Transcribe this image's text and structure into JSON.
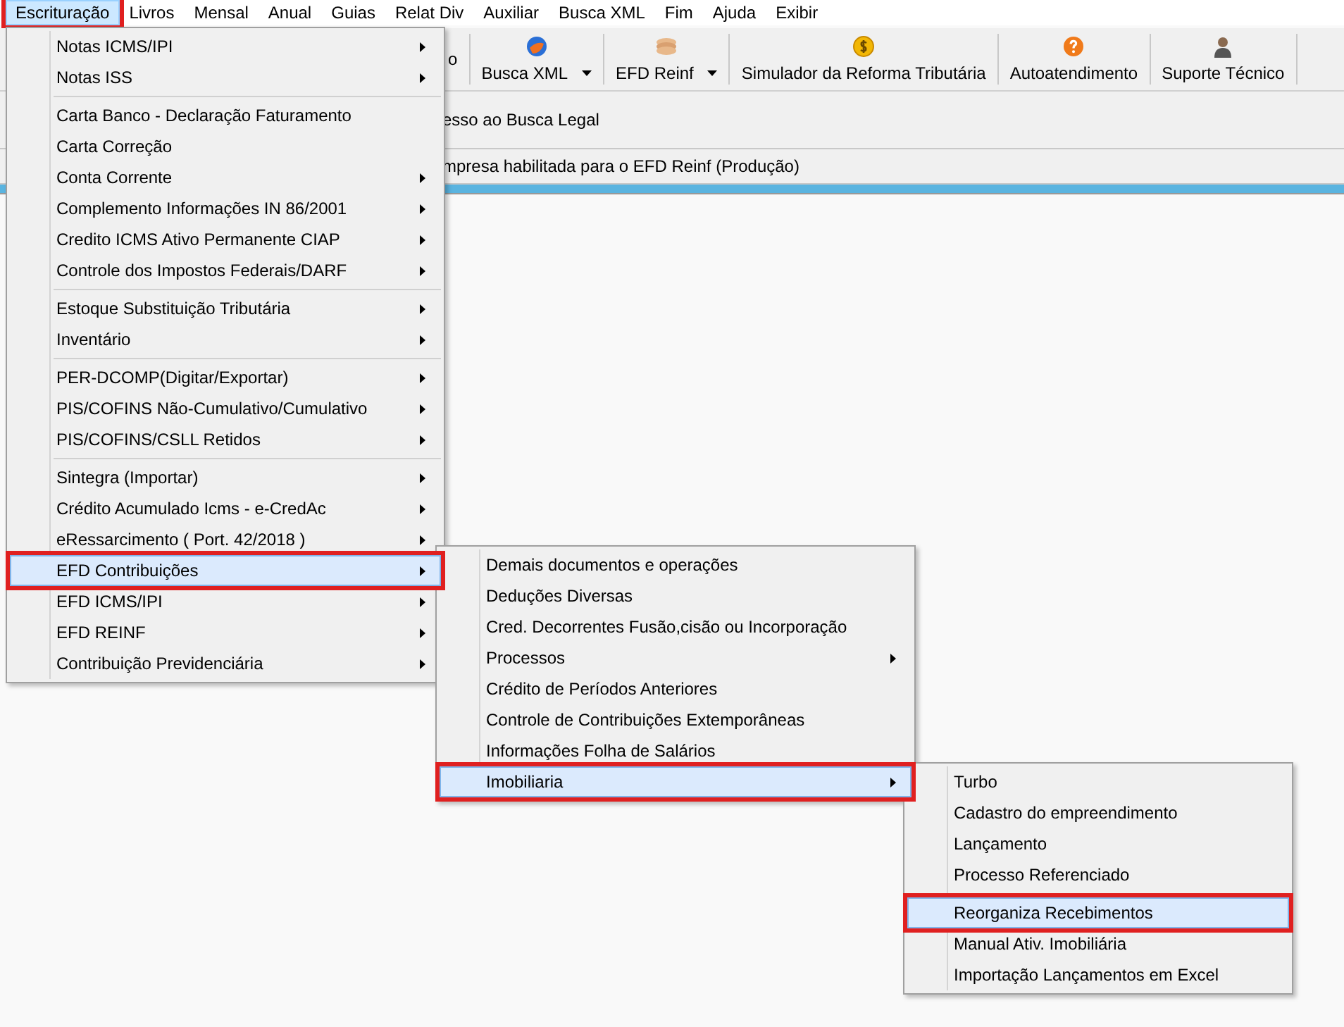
{
  "menu_bar": [
    {
      "label": "Escrituração",
      "selected": true,
      "annotated": true
    },
    {
      "label": "Livros",
      "selected": false,
      "annotated": false
    },
    {
      "label": "Mensal",
      "selected": false,
      "annotated": false
    },
    {
      "label": "Anual",
      "selected": false,
      "annotated": false
    },
    {
      "label": "Guias",
      "selected": false,
      "annotated": false
    },
    {
      "label": "Relat Div",
      "selected": false,
      "annotated": false
    },
    {
      "label": "Auxiliar",
      "selected": false,
      "annotated": false
    },
    {
      "label": "Busca XML",
      "selected": false,
      "annotated": false
    },
    {
      "label": "Fim",
      "selected": false,
      "annotated": false
    },
    {
      "label": "Ajuda",
      "selected": false,
      "annotated": false
    },
    {
      "label": "Exibir",
      "selected": false,
      "annotated": false
    }
  ],
  "toolbar": [
    {
      "label": "o",
      "kind": "text",
      "dropdown": false
    },
    {
      "label": "Busca XML",
      "kind": "globe",
      "dropdown": true
    },
    {
      "label": "EFD Reinf",
      "kind": "coins",
      "dropdown": true
    },
    {
      "label": "Simulador da Reforma Tributária",
      "kind": "dollar",
      "dropdown": false
    },
    {
      "label": "Autoatendimento",
      "kind": "help",
      "dropdown": false
    },
    {
      "label": "Suporte Técnico",
      "kind": "person",
      "dropdown": false
    }
  ],
  "info_lines": [
    "esso ao Busca Legal",
    "mpresa habilitada para o EFD Reinf (Produção)"
  ],
  "main_menu": {
    "groups": [
      [
        {
          "label": "Notas ICMS/IPI",
          "has_submenu": true,
          "selected": false,
          "annotated": false
        },
        {
          "label": "Notas ISS",
          "has_submenu": true,
          "selected": false,
          "annotated": false
        }
      ],
      [
        {
          "label": "Carta Banco - Declaração Faturamento",
          "has_submenu": false,
          "selected": false,
          "annotated": false
        },
        {
          "label": "Carta Correção",
          "has_submenu": false,
          "selected": false,
          "annotated": false
        },
        {
          "label": "Conta Corrente",
          "has_submenu": true,
          "selected": false,
          "annotated": false
        },
        {
          "label": "Complemento Informações IN 86/2001",
          "has_submenu": true,
          "selected": false,
          "annotated": false
        },
        {
          "label": "Credito ICMS Ativo Permanente CIAP",
          "has_submenu": true,
          "selected": false,
          "annotated": false
        },
        {
          "label": "Controle dos Impostos Federais/DARF",
          "has_submenu": true,
          "selected": false,
          "annotated": false
        }
      ],
      [
        {
          "label": "Estoque Substituição Tributária",
          "has_submenu": true,
          "selected": false,
          "annotated": false
        },
        {
          "label": "Inventário",
          "has_submenu": true,
          "selected": false,
          "annotated": false
        }
      ],
      [
        {
          "label": "PER-DCOMP(Digitar/Exportar)",
          "has_submenu": true,
          "selected": false,
          "annotated": false
        },
        {
          "label": "PIS/COFINS Não-Cumulativo/Cumulativo",
          "has_submenu": true,
          "selected": false,
          "annotated": false
        },
        {
          "label": "PIS/COFINS/CSLL Retidos",
          "has_submenu": true,
          "selected": false,
          "annotated": false
        }
      ],
      [
        {
          "label": "Sintegra (Importar)",
          "has_submenu": true,
          "selected": false,
          "annotated": false
        },
        {
          "label": "Crédito Acumulado Icms - e-CredAc",
          "has_submenu": true,
          "selected": false,
          "annotated": false
        },
        {
          "label": "eRessarcimento ( Port. 42/2018 )",
          "has_submenu": true,
          "selected": false,
          "annotated": false
        },
        {
          "label": "EFD Contribuições",
          "has_submenu": true,
          "selected": true,
          "annotated": true
        },
        {
          "label": "EFD ICMS/IPI",
          "has_submenu": true,
          "selected": false,
          "annotated": false
        },
        {
          "label": "EFD REINF",
          "has_submenu": true,
          "selected": false,
          "annotated": false
        },
        {
          "label": "Contribuição Previdenciária",
          "has_submenu": true,
          "selected": false,
          "annotated": false
        }
      ]
    ]
  },
  "submenu_contribuicoes": {
    "groups": [
      [
        {
          "label": "Demais documentos e operações",
          "has_submenu": false,
          "selected": false,
          "annotated": false
        },
        {
          "label": "Deduções Diversas",
          "has_submenu": false,
          "selected": false,
          "annotated": false
        },
        {
          "label": "Cred. Decorrentes Fusão,cisão ou Incorporação",
          "has_submenu": false,
          "selected": false,
          "annotated": false
        },
        {
          "label": "Processos",
          "has_submenu": true,
          "selected": false,
          "annotated": false
        },
        {
          "label": "Crédito de Períodos Anteriores",
          "has_submenu": false,
          "selected": false,
          "annotated": false
        },
        {
          "label": "Controle de Contribuições Extemporâneas",
          "has_submenu": false,
          "selected": false,
          "annotated": false
        },
        {
          "label": "Informações Folha de Salários",
          "has_submenu": false,
          "selected": false,
          "annotated": false
        },
        {
          "label": "Imobiliaria",
          "has_submenu": true,
          "selected": true,
          "annotated": true
        }
      ]
    ]
  },
  "submenu_imobiliaria": {
    "groups": [
      [
        {
          "label": "Turbo",
          "has_submenu": false,
          "selected": false,
          "annotated": false
        },
        {
          "label": "Cadastro do empreendimento",
          "has_submenu": false,
          "selected": false,
          "annotated": false
        },
        {
          "label": "Lançamento",
          "has_submenu": false,
          "selected": false,
          "annotated": false
        },
        {
          "label": "Processo Referenciado",
          "has_submenu": false,
          "selected": false,
          "annotated": false
        }
      ],
      [
        {
          "label": "Reorganiza Recebimentos",
          "has_submenu": false,
          "selected": true,
          "annotated": true
        },
        {
          "label": "Manual Ativ. Imobiliária",
          "has_submenu": false,
          "selected": false,
          "annotated": false
        },
        {
          "label": "Importação Lançamentos em Excel",
          "has_submenu": false,
          "selected": false,
          "annotated": false
        }
      ]
    ]
  }
}
